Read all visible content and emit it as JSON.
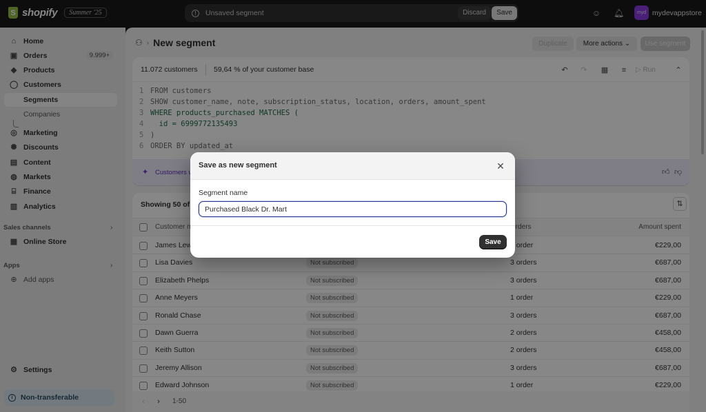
{
  "topbar": {
    "logo_text": "shopify",
    "edition": "Summer '25",
    "unsaved_label": "Unsaved segment",
    "discard_label": "Discard",
    "save_label": "Save",
    "store_avatar": "myd",
    "store_name": "mydevappstore"
  },
  "sidebar": {
    "items": [
      {
        "label": "Home",
        "icon": "home-icon"
      },
      {
        "label": "Orders",
        "icon": "orders-icon",
        "badge": "9.999+"
      },
      {
        "label": "Products",
        "icon": "tag-icon"
      },
      {
        "label": "Customers",
        "icon": "person-icon"
      },
      {
        "label": "Segments",
        "active": true
      },
      {
        "label": "Companies"
      },
      {
        "label": "Marketing",
        "icon": "target-icon"
      },
      {
        "label": "Discounts",
        "icon": "discount-icon"
      },
      {
        "label": "Content",
        "icon": "content-icon"
      },
      {
        "label": "Markets",
        "icon": "globe-icon"
      },
      {
        "label": "Finance",
        "icon": "bank-icon"
      },
      {
        "label": "Analytics",
        "icon": "bar-chart-icon"
      }
    ],
    "sales_channels_title": "Sales channels",
    "online_store": "Online Store",
    "apps_title": "Apps",
    "add_apps": "Add apps",
    "settings": "Settings",
    "non_transferable": "Non-transferable"
  },
  "page": {
    "title": "New segment",
    "duplicate_label": "Duplicate",
    "more_actions_label": "More actions",
    "use_segment_label": "Use segment"
  },
  "editor": {
    "customer_count": "11.072 customers",
    "percent_text": "59,64 % of your customer base",
    "run_label": "Run",
    "code_lines": [
      "FROM customers",
      "SHOW customer_name, note, subscription_status, location, orders, amount_spent",
      "WHERE products_purchased MATCHES (",
      "  id = 6999772135493",
      ")",
      "ORDER BY updated_at"
    ],
    "ai_text": "Customers w"
  },
  "table": {
    "showing": "Showing 50 of",
    "headers": {
      "name": "Customer n",
      "orders": "Orders",
      "amount": "Amount spent"
    },
    "rows": [
      {
        "name": "James Lew",
        "sub": "",
        "orders": "1 order",
        "amount": "€229,00"
      },
      {
        "name": "Lisa Davies",
        "sub": "Not subscribed",
        "orders": "3 orders",
        "amount": "€687,00"
      },
      {
        "name": "Elizabeth Phelps",
        "sub": "Not subscribed",
        "orders": "3 orders",
        "amount": "€687,00"
      },
      {
        "name": "Anne Meyers",
        "sub": "Not subscribed",
        "orders": "1 order",
        "amount": "€229,00"
      },
      {
        "name": "Ronald Chase",
        "sub": "Not subscribed",
        "orders": "3 orders",
        "amount": "€687,00"
      },
      {
        "name": "Dawn Guerra",
        "sub": "Not subscribed",
        "orders": "2 orders",
        "amount": "€458,00"
      },
      {
        "name": "Keith Sutton",
        "sub": "Not subscribed",
        "orders": "2 orders",
        "amount": "€458,00"
      },
      {
        "name": "Jeremy Allison",
        "sub": "Not subscribed",
        "orders": "3 orders",
        "amount": "€687,00"
      },
      {
        "name": "Edward Johnson",
        "sub": "Not subscribed",
        "orders": "1 order",
        "amount": "€229,00"
      }
    ],
    "pagination": "1-50"
  },
  "modal": {
    "title": "Save as new segment",
    "field_label": "Segment name",
    "field_value": "Purchased Black Dr. Mart",
    "save_label": "Save"
  }
}
